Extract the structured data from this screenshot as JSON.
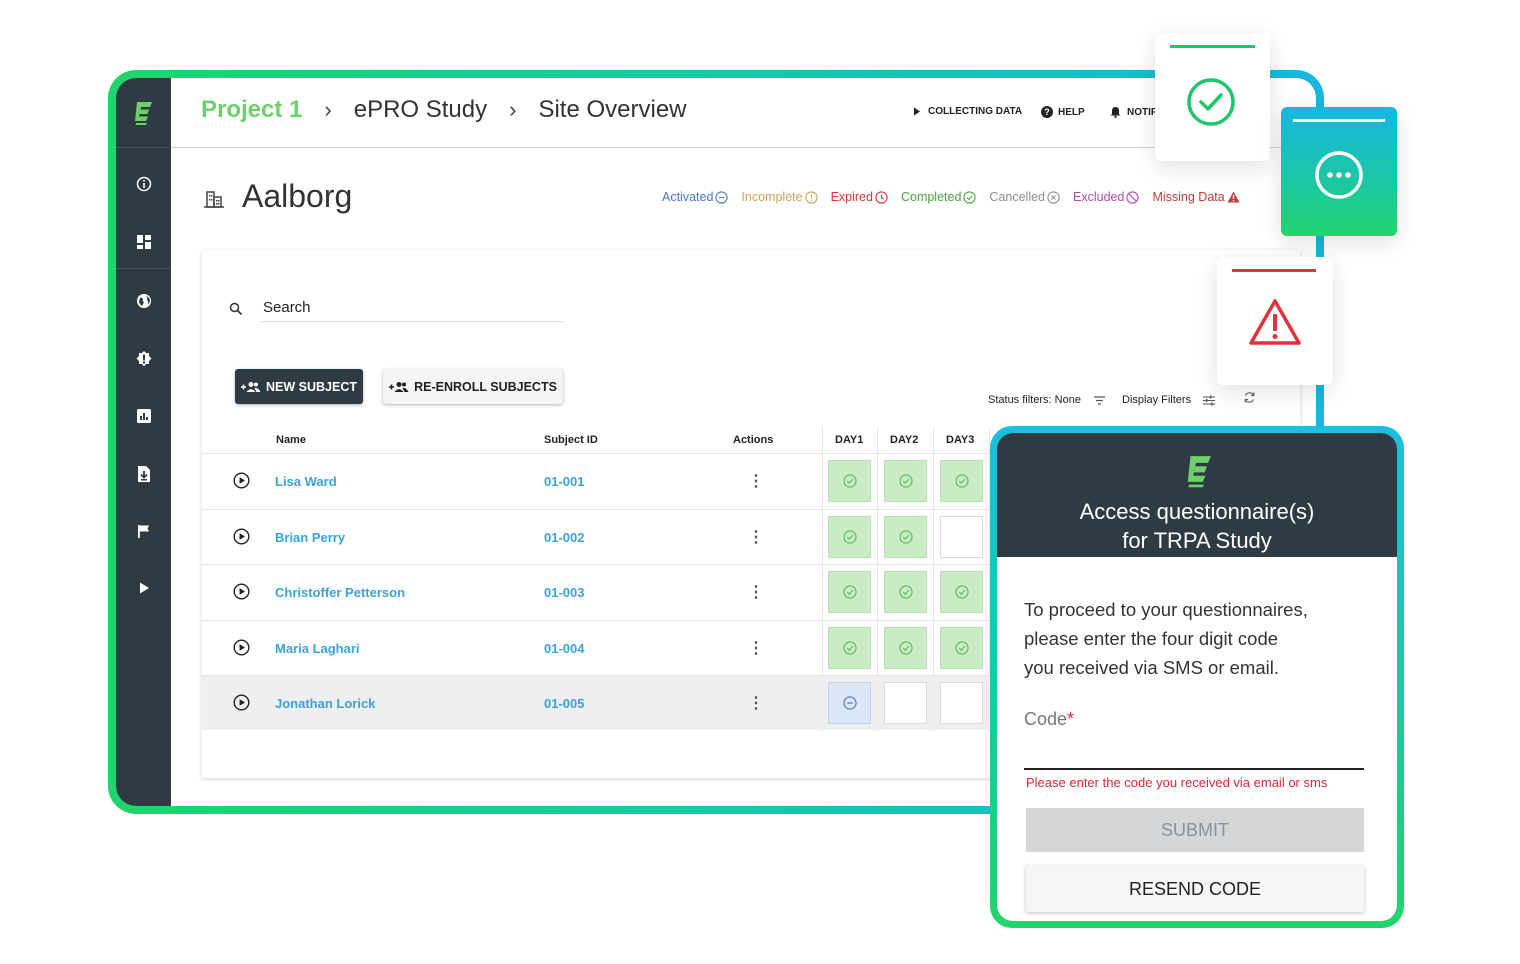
{
  "breadcrumb": {
    "project": "Project 1",
    "study": "ePRO Study",
    "page": "Site Overview"
  },
  "topnav": {
    "collecting": "COLLECTING DATA",
    "help": "HELP",
    "notifications": "NOTIF"
  },
  "site": {
    "name": "Aalborg"
  },
  "legend": [
    {
      "label": "Activated",
      "color": "#4a78c9",
      "icon": "minus-circle"
    },
    {
      "label": "Incomplete",
      "color": "#c9a457",
      "icon": "exclamation-circle"
    },
    {
      "label": "Expired",
      "color": "#d63838",
      "icon": "clock-circle"
    },
    {
      "label": "Completed",
      "color": "#49a83c",
      "icon": "check-circle"
    },
    {
      "label": "Cancelled",
      "color": "#8a8f93",
      "icon": "x-circle"
    },
    {
      "label": "Excluded",
      "color": "#b14bb4",
      "icon": "ban-circle"
    },
    {
      "label": "Missing Data",
      "color": "#c23b3b",
      "icon": "warning-triangle"
    }
  ],
  "search": {
    "label": "Search"
  },
  "buttons": {
    "new_subject": "NEW SUBJECT",
    "reenroll": "RE-ENROLL SUBJECTS"
  },
  "filters": {
    "status": "Status filters: None",
    "display": "Display Filters"
  },
  "table": {
    "headers": {
      "name": "Name",
      "id": "Subject ID",
      "actions": "Actions",
      "day1": "DAY1",
      "day2": "DAY2",
      "day3": "DAY3"
    },
    "rows": [
      {
        "name": "Lisa Ward",
        "id": "01-001",
        "days": [
          "done",
          "done",
          "done"
        ]
      },
      {
        "name": "Brian Perry",
        "id": "01-002",
        "days": [
          "done",
          "done",
          "empty"
        ]
      },
      {
        "name": "Christoffer Petterson",
        "id": "01-003",
        "days": [
          "done",
          "done",
          "done"
        ]
      },
      {
        "name": "Maria Laghari",
        "id": "01-004",
        "days": [
          "done",
          "done",
          "done"
        ]
      },
      {
        "name": "Jonathan Lorick",
        "id": "01-005",
        "days": [
          "activated",
          "empty",
          "empty"
        ]
      }
    ],
    "more_glyph": "⋮"
  },
  "dialog": {
    "title_line1": "Access questionnaire(s)",
    "title_line2": "for TRPA Study",
    "body_line1": "To proceed to your questionnaires,",
    "body_line2": "please enter the four digit code",
    "body_line3": "you received via SMS or email.",
    "code_label": "Code",
    "required_mark": "*",
    "error": "Please enter the code you received via email or sms",
    "submit": "SUBMIT",
    "resend": "RESEND CODE"
  },
  "colors": {
    "brand_green": "#6fd06b",
    "sidebar": "#2f3b42",
    "link_blue": "#3aa3d8",
    "error_red": "#e0263a"
  }
}
